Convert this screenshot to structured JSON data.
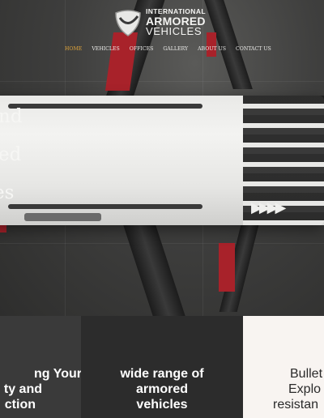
{
  "header": {
    "logo": {
      "line1": "INTERNATIONAL",
      "line2": "ARMORED",
      "line3": "VEHICLES"
    },
    "nav": [
      {
        "label": "HOME",
        "active": true
      },
      {
        "label": "VEHICLES",
        "active": false
      },
      {
        "label": "OFFICES",
        "active": false
      },
      {
        "label": "GALLERY",
        "active": false
      },
      {
        "label": "ABOUT US",
        "active": false
      },
      {
        "label": "CONTACT US",
        "active": false
      }
    ]
  },
  "hero": {
    "lines": [
      "nd",
      "ed",
      "es"
    ]
  },
  "cards": [
    {
      "lines": [
        "ng Your",
        "ty and",
        "ction"
      ],
      "bg": "#3a3a3a",
      "color": "#ffffff"
    },
    {
      "lines": [
        "wide range of",
        "armored",
        "vehicles"
      ],
      "bg": "#2c2c2c",
      "color": "#ffffff"
    },
    {
      "lines": [
        "Bullet",
        "Explo",
        "resistan"
      ],
      "bg": "#f8f4f1",
      "color": "#2a2a2a"
    }
  ],
  "colors": {
    "accent": "#e0a43a",
    "nav_text": "#ededeb"
  }
}
